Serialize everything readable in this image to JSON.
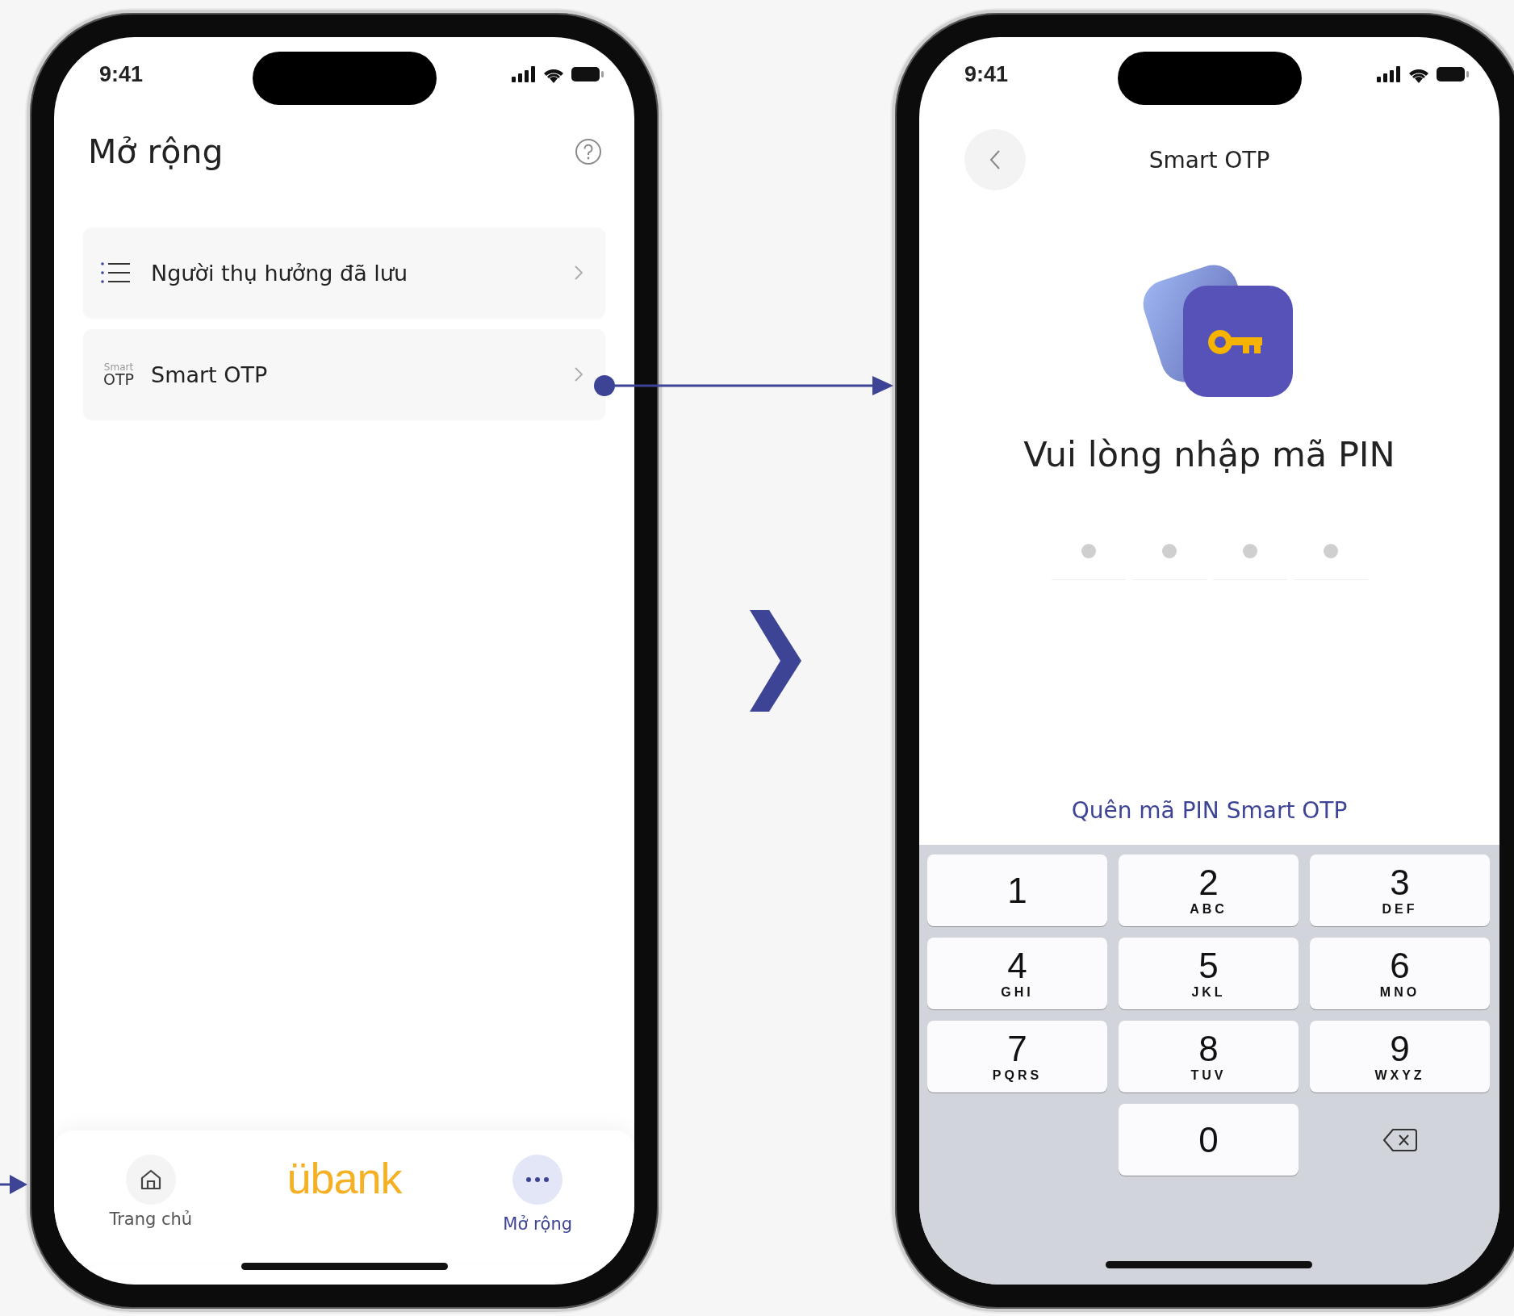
{
  "left_screen": {
    "status_time": "9:41",
    "title": "Mở rộng",
    "menu_items": [
      {
        "kind": "list",
        "label": "Người thụ hưởng đã lưu"
      },
      {
        "kind": "otp",
        "icon_top": "Smart",
        "icon_bottom": "OTP",
        "label": "Smart OTP"
      }
    ],
    "tab_bar": {
      "logo": "übank",
      "tabs": [
        {
          "kind": "home",
          "label": "Trang chủ",
          "selected": false
        },
        {
          "kind": "more",
          "label": "Mở rộng",
          "selected": true
        }
      ]
    }
  },
  "right_screen": {
    "status_time": "9:41",
    "title": "Smart OTP",
    "heading": "Vui lòng nhập mã PIN",
    "pin_slots": [
      {
        "filled": false
      },
      {
        "filled": false
      },
      {
        "filled": false
      },
      {
        "filled": false
      }
    ],
    "forgot_link": "Quên mã PIN Smart OTP",
    "keypad": [
      {
        "kind": "digit",
        "digit": "1"
      },
      {
        "kind": "digit",
        "digit": "2",
        "letters": "ABC"
      },
      {
        "kind": "digit",
        "digit": "3",
        "letters": "DEF"
      },
      {
        "kind": "digit",
        "digit": "4",
        "letters": "GHI"
      },
      {
        "kind": "digit",
        "digit": "5",
        "letters": "JKL"
      },
      {
        "kind": "digit",
        "digit": "6",
        "letters": "MNO"
      },
      {
        "kind": "digit",
        "digit": "7",
        "letters": "PQRS"
      },
      {
        "kind": "digit",
        "digit": "8",
        "letters": "TUV"
      },
      {
        "kind": "digit",
        "digit": "9",
        "letters": "WXYZ"
      },
      {
        "kind": "blank"
      },
      {
        "kind": "digit",
        "digit": "0"
      },
      {
        "kind": "delete"
      }
    ]
  }
}
